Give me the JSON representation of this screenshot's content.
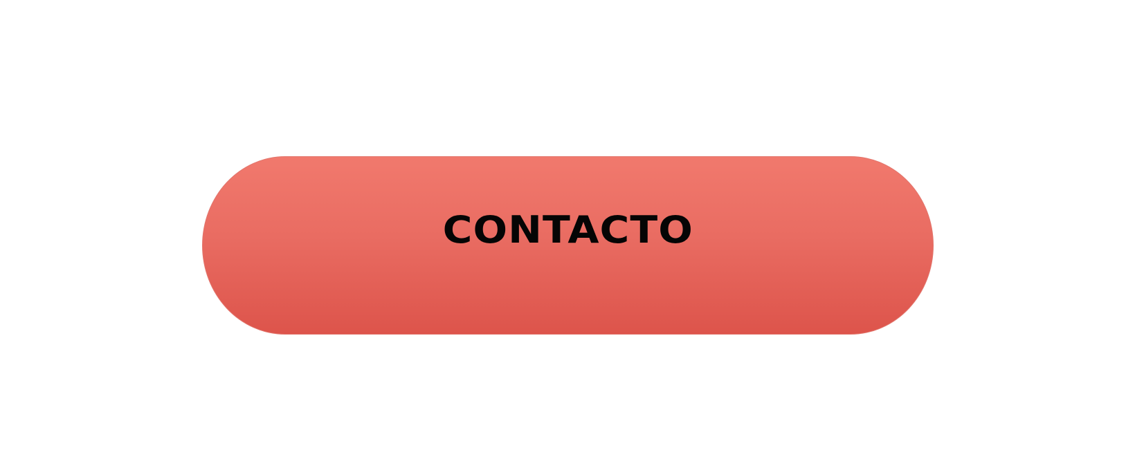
{
  "button": {
    "label": "CONTACTO",
    "color_top": "#f1796d",
    "color_bottom": "#dd544b",
    "text_color": "#050505"
  }
}
